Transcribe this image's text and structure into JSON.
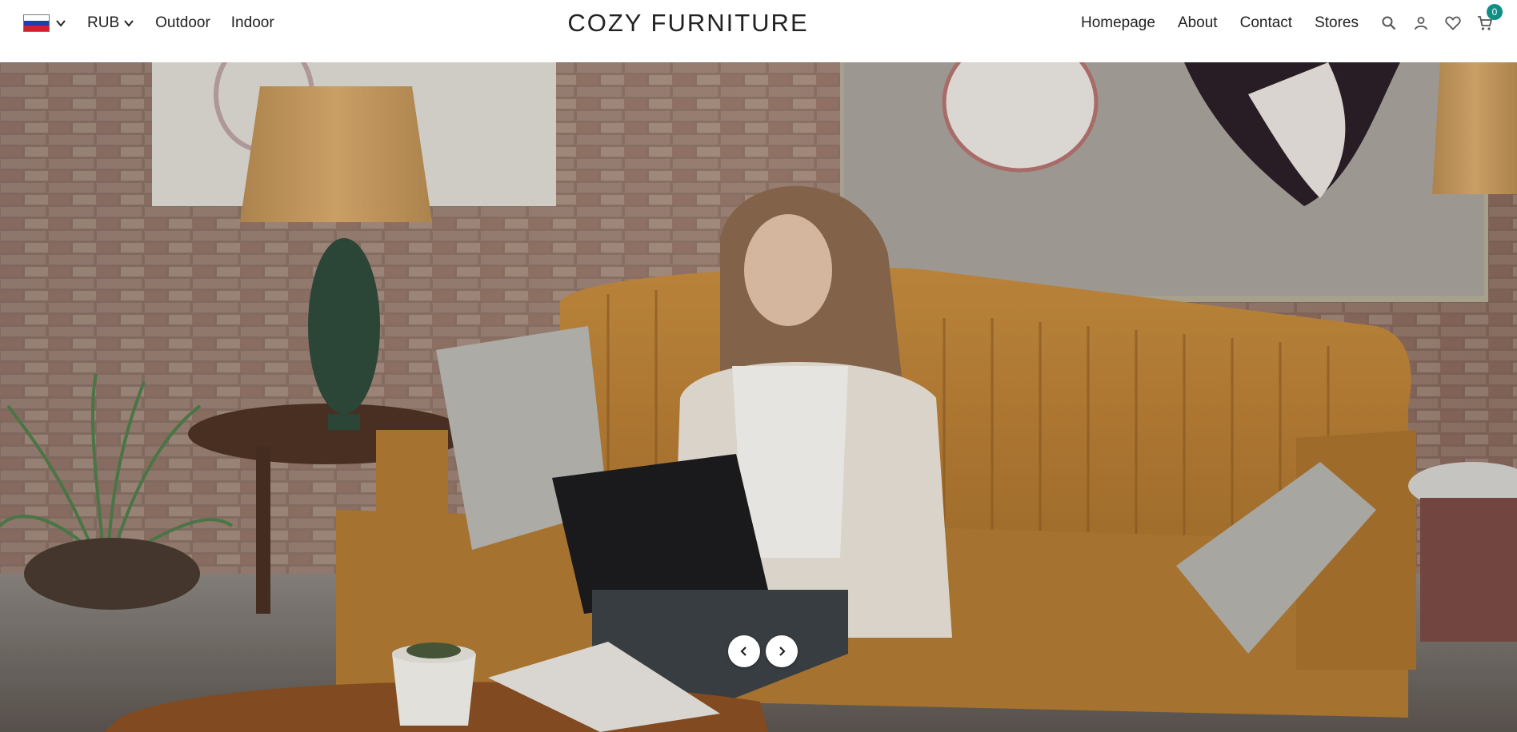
{
  "header": {
    "country": {
      "flag": "russia-flag",
      "code": "RU"
    },
    "currency": "RUB",
    "left_nav": [
      {
        "label": "Outdoor"
      },
      {
        "label": "Indoor"
      }
    ],
    "logo": "COZY FURNITURE",
    "right_nav": [
      {
        "label": "Homepage"
      },
      {
        "label": "About"
      },
      {
        "label": "Contact"
      },
      {
        "label": "Stores"
      }
    ],
    "icons": [
      "search-icon",
      "account-icon",
      "wishlist-icon",
      "cart-icon"
    ],
    "cart_count": "0"
  },
  "hero": {
    "image": "woman-on-sofa-with-laptop",
    "controls": {
      "prev_icon": "chevron-left-icon",
      "next_icon": "chevron-right-icon"
    }
  },
  "colors": {
    "accent": "#0f8f86",
    "text": "#222222",
    "background": "#ffffff"
  }
}
